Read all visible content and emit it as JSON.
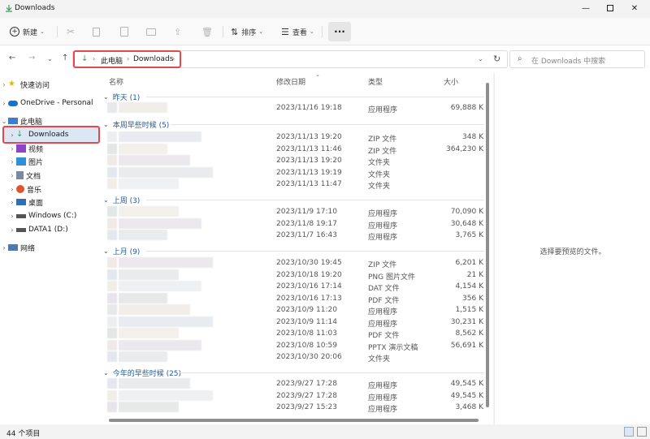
{
  "window": {
    "title": "Downloads"
  },
  "toolbar": {
    "new_label": "新建",
    "sort_label": "排序",
    "view_label": "查看",
    "more_label": "···"
  },
  "address": {
    "crumbs": [
      "此电脑",
      "Downloads"
    ],
    "search_placeholder": "在 Downloads 中搜索"
  },
  "sidebar": {
    "items": [
      {
        "label": "快速访问",
        "icon": "star-icon"
      },
      {
        "label": "OneDrive - Personal",
        "icon": "cloud-icon"
      },
      {
        "label": "此电脑",
        "icon": "computer-icon"
      },
      {
        "label": "Downloads",
        "icon": "download-icon"
      },
      {
        "label": "视频",
        "icon": "video-icon"
      },
      {
        "label": "图片",
        "icon": "picture-icon"
      },
      {
        "label": "文档",
        "icon": "document-icon"
      },
      {
        "label": "音乐",
        "icon": "music-icon"
      },
      {
        "label": "桌面",
        "icon": "desktop-icon"
      },
      {
        "label": "Windows (C:)",
        "icon": "drive-icon"
      },
      {
        "label": "DATA1 (D:)",
        "icon": "drive-icon"
      },
      {
        "label": "网络",
        "icon": "network-icon"
      }
    ]
  },
  "columns": {
    "name": "名称",
    "date": "修改日期",
    "type": "类型",
    "size": "大小"
  },
  "groups": [
    {
      "label": "昨天 (1)",
      "rows": [
        {
          "date": "2023/11/16 19:18",
          "type": "应用程序",
          "size": "69,888 K"
        }
      ]
    },
    {
      "label": "本周早些时候 (5)",
      "rows": [
        {
          "date": "2023/11/13 19:20",
          "type": "ZIP 文件",
          "size": "348 K"
        },
        {
          "date": "2023/11/13 11:46",
          "type": "ZIP 文件",
          "size": "364,230 K"
        },
        {
          "date": "2023/11/13 19:20",
          "type": "文件夹",
          "size": ""
        },
        {
          "date": "2023/11/13 19:19",
          "type": "文件夹",
          "size": ""
        },
        {
          "date": "2023/11/13 11:47",
          "type": "文件夹",
          "size": ""
        }
      ]
    },
    {
      "label": "上周 (3)",
      "rows": [
        {
          "date": "2023/11/9 17:10",
          "type": "应用程序",
          "size": "70,090 K"
        },
        {
          "date": "2023/11/8 19:17",
          "type": "应用程序",
          "size": "30,648 K"
        },
        {
          "date": "2023/11/7 16:43",
          "type": "应用程序",
          "size": "3,765 K"
        }
      ]
    },
    {
      "label": "上月 (9)",
      "rows": [
        {
          "date": "2023/10/30 19:45",
          "type": "ZIP 文件",
          "size": "6,201 K"
        },
        {
          "date": "2023/10/18 19:20",
          "type": "PNG 图片文件",
          "size": "21 K"
        },
        {
          "date": "2023/10/16 17:14",
          "type": "DAT 文件",
          "size": "4,154 K"
        },
        {
          "date": "2023/10/16 17:13",
          "type": "PDF 文件",
          "size": "356 K"
        },
        {
          "date": "2023/10/9 11:20",
          "type": "应用程序",
          "size": "1,515 K"
        },
        {
          "date": "2023/10/9 11:14",
          "type": "应用程序",
          "size": "30,231 K"
        },
        {
          "date": "2023/10/8 11:03",
          "type": "PDF 文件",
          "size": "8,562 K"
        },
        {
          "date": "2023/10/8 10:59",
          "type": "PPTX 演示文稿",
          "size": "56,691 K"
        },
        {
          "date": "2023/10/30 20:06",
          "type": "文件夹",
          "size": ""
        }
      ]
    },
    {
      "label": "今年的早些时候 (25)",
      "rows": [
        {
          "date": "2023/9/27 17:28",
          "type": "应用程序",
          "size": "49,545 K"
        },
        {
          "date": "2023/9/27 17:28",
          "type": "应用程序",
          "size": "49,545 K"
        },
        {
          "date": "2023/9/27 15:23",
          "type": "应用程序",
          "size": "3,468 K"
        }
      ]
    }
  ],
  "preview": {
    "message": "选择要预览的文件。"
  },
  "status": {
    "count": "44 个项目"
  },
  "colors": {
    "accent": "#1e5a9a",
    "highlight": "#e8484b",
    "selected": "#dbe7f5"
  }
}
